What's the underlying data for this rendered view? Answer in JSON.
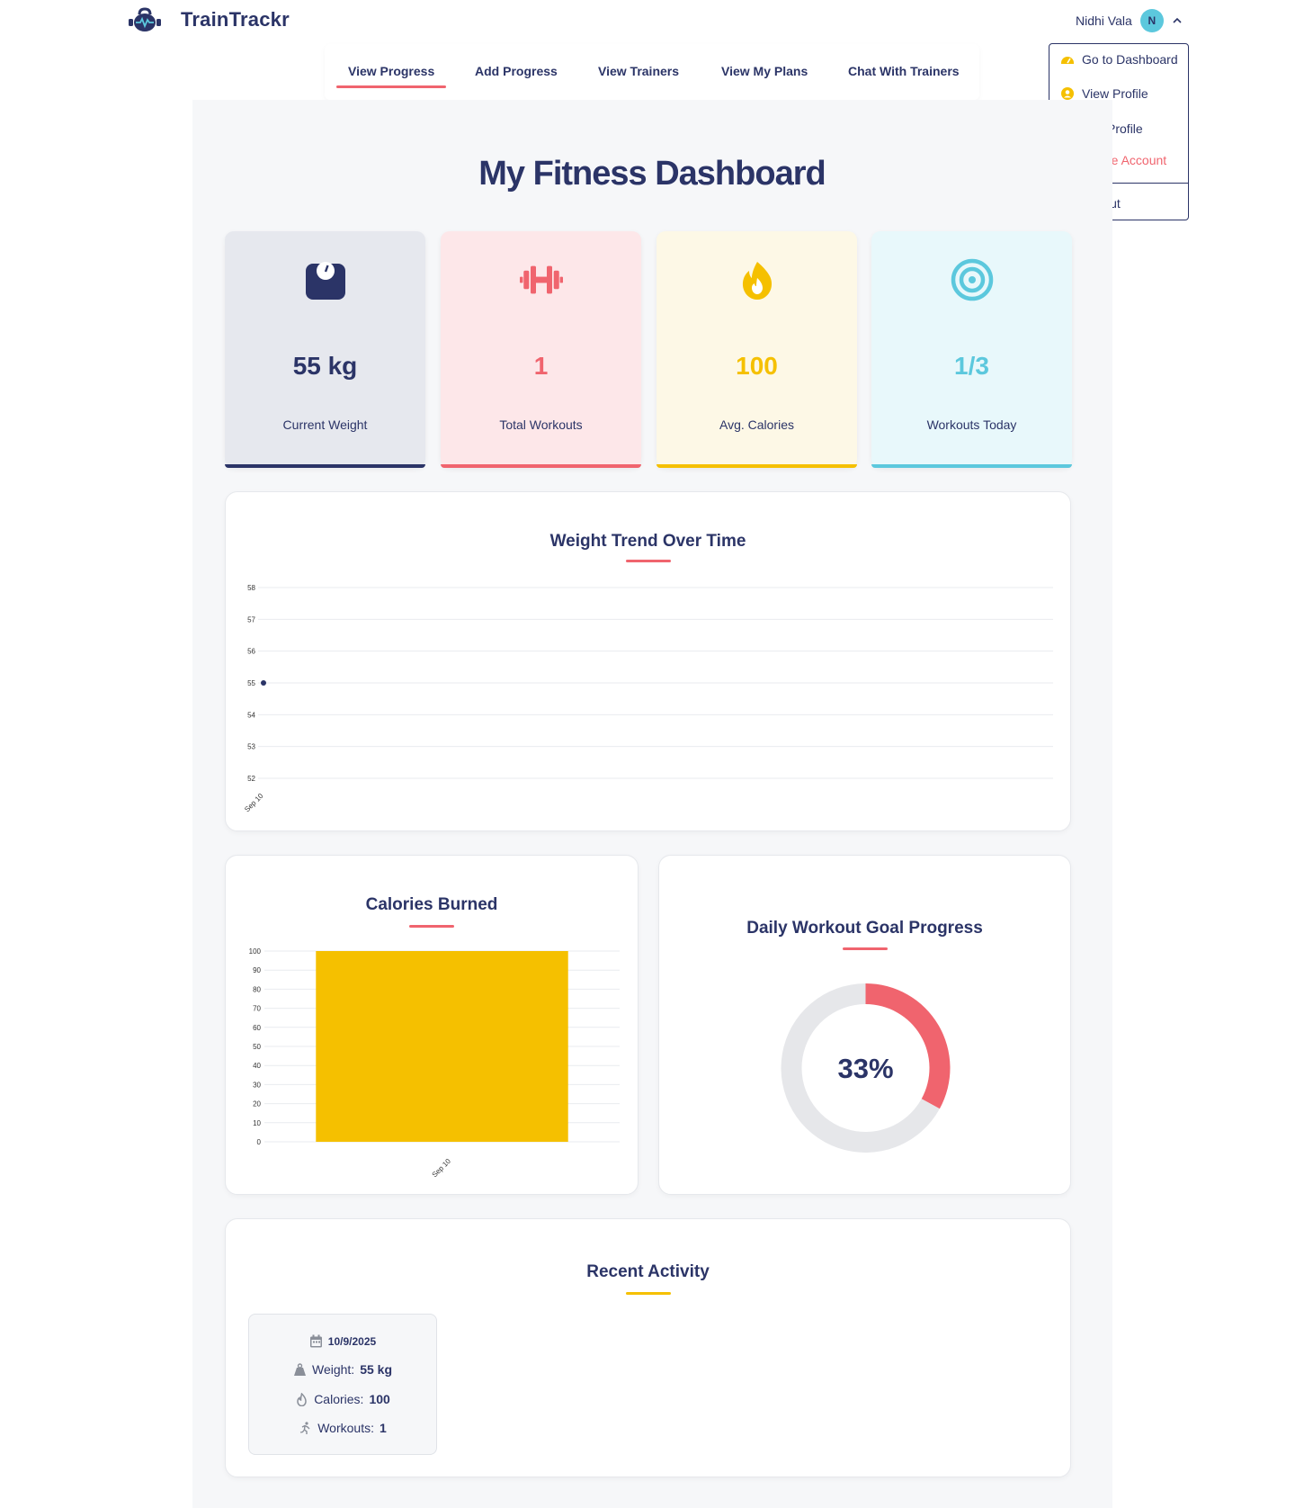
{
  "brand": {
    "name": "TrainTrackr",
    "logo": "kettlebell-heartbeat-logo"
  },
  "user": {
    "name": "Nidhi Vala",
    "initial": "N"
  },
  "user_menu": {
    "items": [
      {
        "label": "Go to Dashboard",
        "icon": "gauge-icon"
      },
      {
        "label": "View Profile",
        "icon": "user-circle-icon"
      },
      {
        "label": "Edit Profile",
        "icon": "user-edit-icon"
      },
      {
        "label": "Delete Account",
        "icon": "trash-icon"
      },
      {
        "label": "Logout",
        "icon": "logout-icon"
      }
    ]
  },
  "nav": {
    "tabs": [
      "View Progress",
      "Add Progress",
      "View Trainers",
      "View My Plans",
      "Chat With Trainers"
    ],
    "active": "View Progress"
  },
  "page": {
    "title": "My Fitness Dashboard"
  },
  "stats": [
    {
      "value": "55 kg",
      "label": "Current Weight",
      "icon": "weight-scale-icon",
      "color": "#2b3467",
      "bg": "#e6e8ee"
    },
    {
      "value": "1",
      "label": "Total Workouts",
      "icon": "dumbbell-icon",
      "color": "#f0646e",
      "bg": "#fde7e9"
    },
    {
      "value": "100",
      "label": "Avg. Calories",
      "icon": "fire-icon",
      "color": "#f5c000",
      "bg": "#fdf8e6"
    },
    {
      "value": "1/3",
      "label": "Workouts Today",
      "icon": "target-icon",
      "color": "#5cc8dd",
      "bg": "#e8f8fb"
    }
  ],
  "weight_panel": {
    "title": "Weight Trend Over Time"
  },
  "calories_panel": {
    "title": "Calories Burned"
  },
  "goal_panel": {
    "title": "Daily Workout Goal Progress",
    "percent_label": "33%"
  },
  "activity": {
    "title": "Recent Activity",
    "entries": [
      {
        "date": "10/9/2025",
        "weight_label": "Weight:",
        "weight": "55 kg",
        "calories_label": "Calories:",
        "calories": "100",
        "workouts_label": "Workouts:",
        "workouts": "1"
      }
    ]
  },
  "colors": {
    "navy": "#2b3467",
    "coral": "#f0646e",
    "yellow": "#f5c000",
    "cyan": "#5cc8dd"
  },
  "chart_data": [
    {
      "type": "line",
      "title": "Weight Trend Over Time",
      "x": [
        "Sep 10"
      ],
      "series": [
        {
          "values": [
            55
          ]
        }
      ],
      "yticks": [
        58,
        57,
        56,
        55,
        54,
        53,
        52
      ],
      "ylim": [
        52,
        58
      ],
      "grid": true
    },
    {
      "type": "bar",
      "title": "Calories Burned",
      "categories": [
        "Sep 10"
      ],
      "values": [
        100
      ],
      "yticks": [
        100,
        90,
        80,
        70,
        60,
        50,
        40,
        30,
        20,
        10,
        0
      ],
      "ylim": [
        0,
        100
      ],
      "grid": true
    },
    {
      "type": "pie",
      "title": "Daily Workout Goal Progress",
      "values": [
        33,
        67
      ],
      "center_label": "33%"
    }
  ]
}
